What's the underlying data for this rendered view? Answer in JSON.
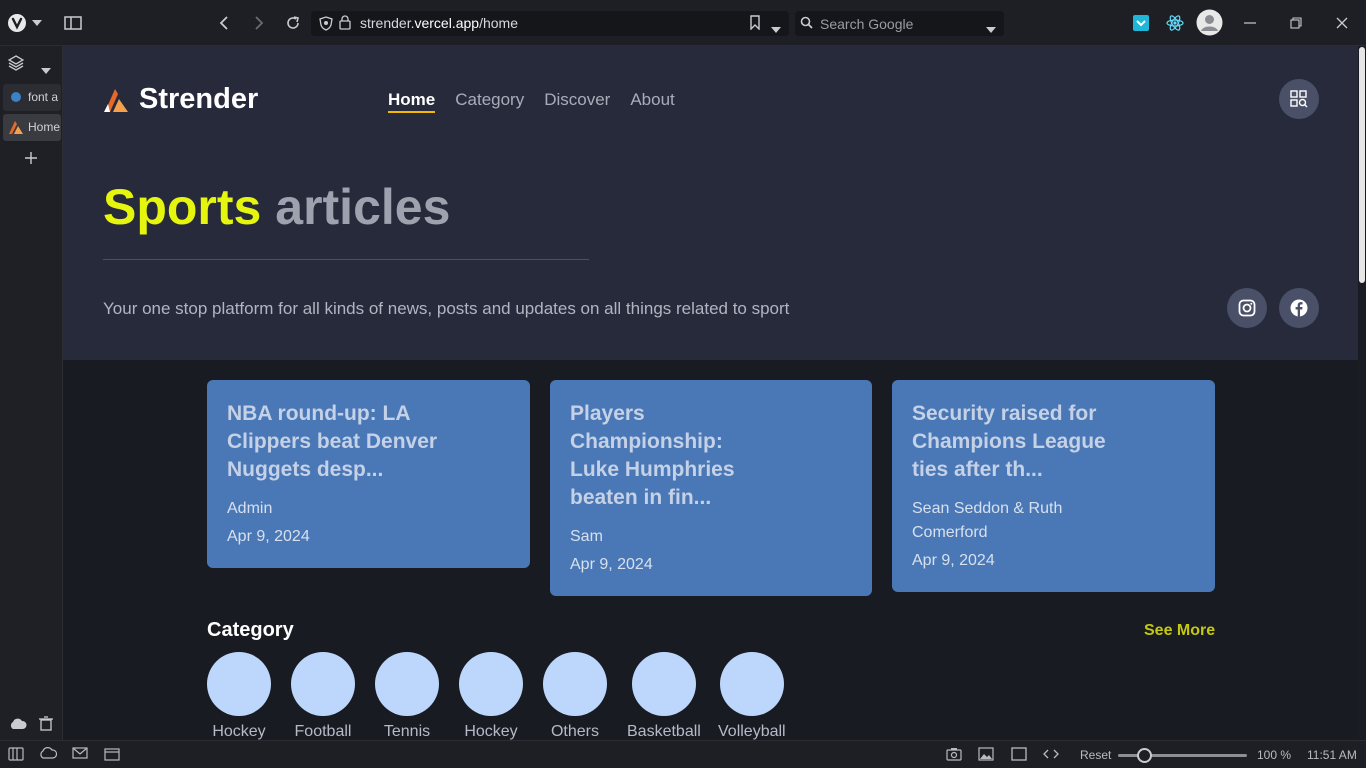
{
  "browser": {
    "url_host_prefix": "strender.",
    "url_host_main": "vercel.app",
    "url_path": "/home",
    "search_placeholder": "Search Google"
  },
  "sidepanel": {
    "tabs": [
      {
        "label": "font a"
      },
      {
        "label": "Home"
      }
    ]
  },
  "statusbar": {
    "reset_label": "Reset",
    "zoom": "100 %",
    "time": "11:51 AM",
    "zoom_level": 1.0
  },
  "site": {
    "logo_text": "Strender",
    "nav": [
      {
        "label": "Home",
        "active": true
      },
      {
        "label": "Category",
        "active": false
      },
      {
        "label": "Discover",
        "active": false
      },
      {
        "label": "About",
        "active": false
      }
    ],
    "hero": {
      "title_highlight": "Sports",
      "title_rest": "articles",
      "subtitle": "Your one stop platform for all kinds of news, posts and updates on all things related to sport"
    },
    "articles": [
      {
        "title": "NBA round-up: LA Clippers beat Denver Nuggets desp...",
        "author": "Admin",
        "date": "Apr 9, 2024"
      },
      {
        "title": "Players Championship: Luke Humphries beaten in fin...",
        "author": "Sam",
        "date": "Apr 9, 2024"
      },
      {
        "title": "Security raised for Champions League ties after th...",
        "author": "Sean Seddon & Ruth Comerford",
        "date": "Apr 9, 2024"
      }
    ],
    "category_section": {
      "heading": "Category",
      "see_more": "See More",
      "items": [
        "Hockey",
        "Football",
        "Tennis",
        "Hockey",
        "Others",
        "Basketball",
        "Volleyball"
      ]
    }
  },
  "colors": {
    "accent_yellow": "#e5f50d",
    "card_blue": "#4a78b6",
    "hero_bg": "#262a3b",
    "page_bg": "#191b23",
    "category_circle": "#bcd7fb"
  }
}
